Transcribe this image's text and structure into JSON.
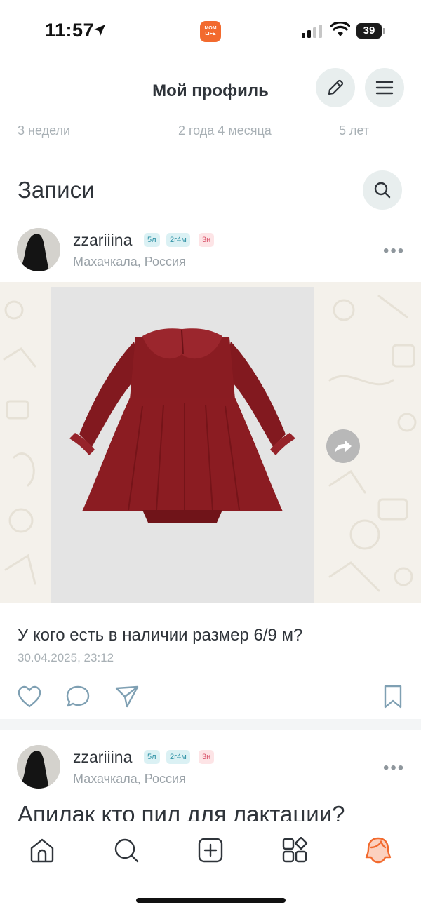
{
  "status_bar": {
    "time": "11:57",
    "app_badge": "MOM LIFE",
    "battery": "39"
  },
  "header": {
    "title": "Мой профиль"
  },
  "ages": [
    "3 недели",
    "2 года 4 месяца",
    "5 лет"
  ],
  "section": {
    "title": "Записи"
  },
  "posts": [
    {
      "username": "zzariiina",
      "badges": [
        "5л",
        "2г4м",
        "3н"
      ],
      "location": "Махачкала, Россия",
      "text": "У кого есть в наличии размер 6/9 м?",
      "date": "30.04.2025, 23:12"
    },
    {
      "username": "zzariiina",
      "badges": [
        "5л",
        "2г4м",
        "3н"
      ],
      "location": "Махачкала, Россия",
      "text": "Апилак кто пил для лактации?"
    }
  ],
  "more_symbol": "•••",
  "colors": {
    "accent": "#f26a2e",
    "badge_teal": "#2a8fa3",
    "badge_pink": "#d9536a",
    "dress": "#8b1c22"
  },
  "bottom_nav": {
    "items": [
      "home-icon",
      "search-icon",
      "add-icon",
      "catalog-icon",
      "profile-icon"
    ],
    "active": "profile-icon"
  }
}
